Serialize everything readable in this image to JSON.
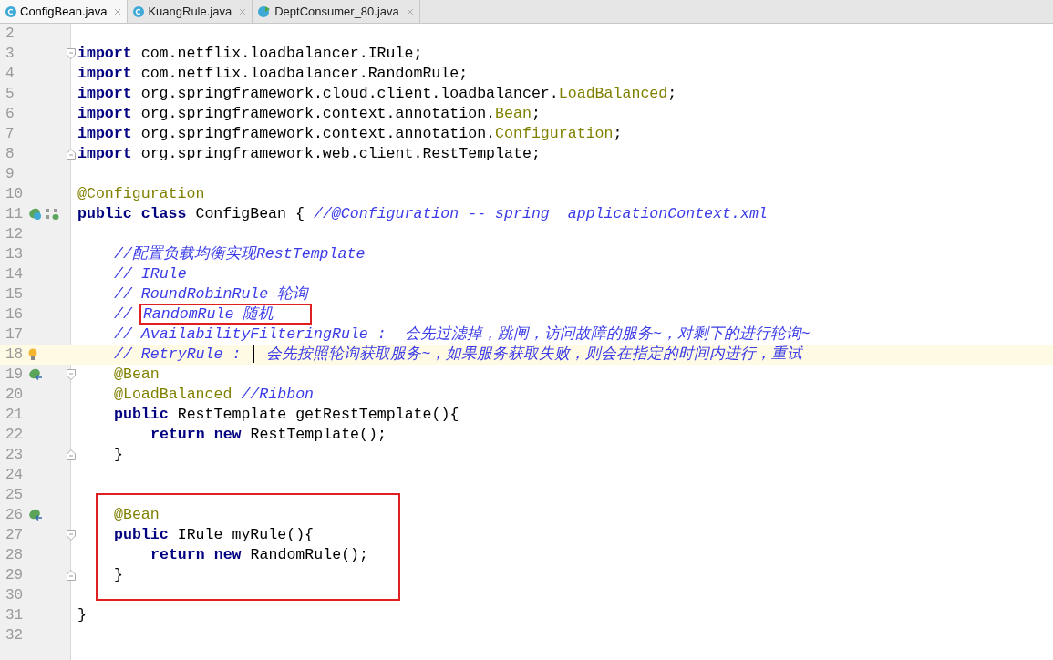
{
  "tabs": [
    {
      "label": "ConfigBean.java",
      "kind": "class",
      "selected": true
    },
    {
      "label": "KuangRule.java",
      "kind": "class",
      "selected": false
    },
    {
      "label": "DeptConsumer_80.java",
      "kind": "runnable",
      "selected": false
    }
  ],
  "lines": [
    {
      "number": "2"
    },
    {
      "number": "3",
      "fold": {
        "kind": "open"
      },
      "tokens": [
        {
          "kind": "keyword",
          "text": "import"
        },
        {
          "kind": "plain",
          "text": " com.netflix.loadbalancer.IRule;"
        }
      ]
    },
    {
      "number": "4",
      "tokens": [
        {
          "kind": "keyword",
          "text": "import"
        },
        {
          "kind": "plain",
          "text": " com.netflix.loadbalancer.RandomRule;"
        }
      ]
    },
    {
      "number": "5",
      "tokens": [
        {
          "kind": "keyword",
          "text": "import"
        },
        {
          "kind": "plain",
          "text": " org.springframework.cloud.client.loadbalancer."
        },
        {
          "kind": "annotation",
          "text": "LoadBalanced"
        },
        {
          "kind": "plain",
          "text": ";"
        }
      ]
    },
    {
      "number": "6",
      "tokens": [
        {
          "kind": "keyword",
          "text": "import"
        },
        {
          "kind": "plain",
          "text": " org.springframework.context.annotation."
        },
        {
          "kind": "annotation",
          "text": "Bean"
        },
        {
          "kind": "plain",
          "text": ";"
        }
      ]
    },
    {
      "number": "7",
      "tokens": [
        {
          "kind": "keyword",
          "text": "import"
        },
        {
          "kind": "plain",
          "text": " org.springframework.context.annotation."
        },
        {
          "kind": "annotation",
          "text": "Configuration"
        },
        {
          "kind": "plain",
          "text": ";"
        }
      ]
    },
    {
      "number": "8",
      "fold": {
        "kind": "close"
      },
      "tokens": [
        {
          "kind": "keyword",
          "text": "import"
        },
        {
          "kind": "plain",
          "text": " org.springframework.web.client.RestTemplate;"
        }
      ]
    },
    {
      "number": "9"
    },
    {
      "number": "10",
      "tokens": [
        {
          "kind": "annotation",
          "text": "@Configuration"
        }
      ]
    },
    {
      "number": "11",
      "gutter": [
        {
          "kind": "bean-class"
        },
        {
          "kind": "diagram"
        }
      ],
      "tokens": [
        {
          "kind": "keyword",
          "text": "public class"
        },
        {
          "kind": "plain",
          "text": " ConfigBean { "
        },
        {
          "kind": "comment",
          "text": "//@Configuration -- spring  applicationContext.xml"
        }
      ]
    },
    {
      "number": "12"
    },
    {
      "number": "13",
      "kind": "member",
      "tokens": [
        {
          "kind": "comment",
          "text": "//配置负载均衡实现RestTemplate"
        }
      ]
    },
    {
      "number": "14",
      "kind": "member",
      "tokens": [
        {
          "kind": "comment",
          "text": "// IRule"
        }
      ]
    },
    {
      "number": "15",
      "kind": "member",
      "tokens": [
        {
          "kind": "comment",
          "text": "// RoundRobinRule 轮询"
        }
      ]
    },
    {
      "number": "16",
      "kind": "member",
      "tokens": [
        {
          "kind": "comment",
          "text": "// "
        },
        {
          "kind": "comment",
          "boxed": true,
          "text": "RandomRule 随机"
        }
      ]
    },
    {
      "number": "17",
      "kind": "member",
      "tokens": [
        {
          "kind": "comment",
          "text": "// AvailabilityFilteringRule :  会先过滤掉，跳闸，访问故障的服务~，对剩下的进行轮询~"
        }
      ]
    },
    {
      "number": "18",
      "kind": "member",
      "current": true,
      "gutter": [
        {
          "kind": "bulb"
        }
      ],
      "tokens": [
        {
          "kind": "comment",
          "text": "// RetryRule : "
        },
        {
          "kind": "caret"
        },
        {
          "kind": "comment",
          "text": " 会先按照轮询获取服务~，如果服务获取失败，则会在指定的时间内进行，重试"
        }
      ]
    },
    {
      "number": "19",
      "kind": "member",
      "fold": {
        "kind": "open"
      },
      "gutter": [
        {
          "kind": "bean-arrow"
        }
      ],
      "tokens": [
        {
          "kind": "annotation",
          "text": "@Bean"
        }
      ]
    },
    {
      "number": "20",
      "kind": "member",
      "tokens": [
        {
          "kind": "annotation",
          "text": "@LoadBalanced"
        },
        {
          "kind": "comment",
          "text": " //Ribbon"
        }
      ]
    },
    {
      "number": "21",
      "kind": "member",
      "tokens": [
        {
          "kind": "keyword",
          "text": "public"
        },
        {
          "kind": "plain",
          "text": " RestTemplate getRestTemplate(){"
        }
      ]
    },
    {
      "number": "22",
      "kind": "body",
      "tokens": [
        {
          "kind": "keyword",
          "text": "return new"
        },
        {
          "kind": "plain",
          "text": " RestTemplate();"
        }
      ]
    },
    {
      "number": "23",
      "kind": "member",
      "fold": {
        "kind": "close"
      },
      "tokens": [
        {
          "kind": "plain",
          "text": "}"
        }
      ]
    },
    {
      "number": "24"
    },
    {
      "number": "25"
    },
    {
      "number": "26",
      "kind": "member",
      "in_box": true,
      "gutter": [
        {
          "kind": "bean-arrow"
        }
      ],
      "tokens": [
        {
          "kind": "annotation",
          "text": "@Bean"
        }
      ]
    },
    {
      "number": "27",
      "kind": "member",
      "in_box": true,
      "fold": {
        "kind": "open"
      },
      "tokens": [
        {
          "kind": "keyword",
          "text": "public"
        },
        {
          "kind": "plain",
          "text": " IRule myRule(){"
        }
      ]
    },
    {
      "number": "28",
      "kind": "body",
      "in_box": true,
      "tokens": [
        {
          "kind": "keyword",
          "text": "return new"
        },
        {
          "kind": "plain",
          "text": " RandomRule();"
        }
      ]
    },
    {
      "number": "29",
      "kind": "member",
      "in_box": true,
      "fold": {
        "kind": "close"
      },
      "tokens": [
        {
          "kind": "plain",
          "text": "}"
        }
      ]
    },
    {
      "number": "30"
    },
    {
      "number": "31",
      "tokens": [
        {
          "kind": "plain",
          "text": "}"
        }
      ]
    },
    {
      "number": "32"
    }
  ]
}
